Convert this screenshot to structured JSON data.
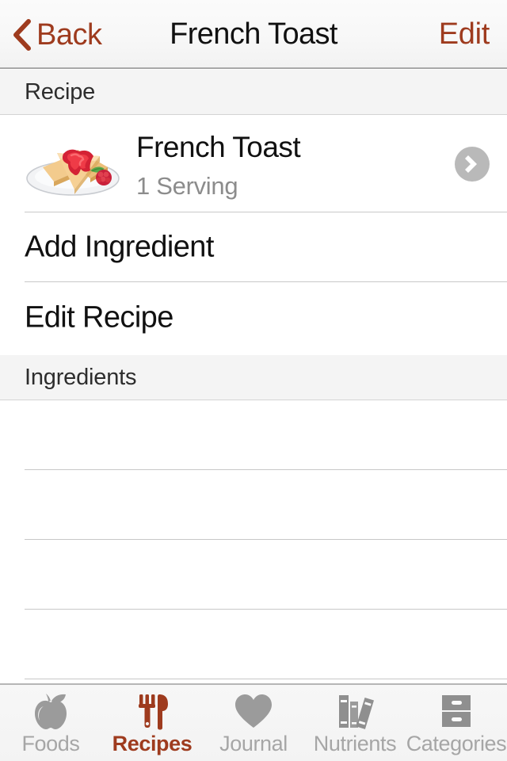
{
  "navbar": {
    "back_label": "Back",
    "title": "French Toast",
    "edit_label": "Edit",
    "accent_color": "#9e3b1e"
  },
  "sections": {
    "recipe_header": "Recipe",
    "ingredients_header": "Ingredients"
  },
  "recipe": {
    "name": "French Toast",
    "servings": "1 Serving",
    "thumbnail_icon": "french-toast-plate-image"
  },
  "actions": {
    "add_ingredient": "Add Ingredient",
    "edit_recipe": "Edit Recipe"
  },
  "ingredients": {
    "items": [],
    "empty_row_count": 4
  },
  "tabbar": {
    "active": "Recipes",
    "items": [
      {
        "label": "Foods",
        "icon": "apple-icon",
        "active": false
      },
      {
        "label": "Recipes",
        "icon": "fork-knife-icon",
        "active": true
      },
      {
        "label": "Journal",
        "icon": "heart-icon",
        "active": false
      },
      {
        "label": "Nutrients",
        "icon": "books-icon",
        "active": false
      },
      {
        "label": "Categories",
        "icon": "file-cabinet-icon",
        "active": false
      }
    ],
    "inactive_color": "#a6a6a6",
    "active_color": "#9e3b1e"
  }
}
